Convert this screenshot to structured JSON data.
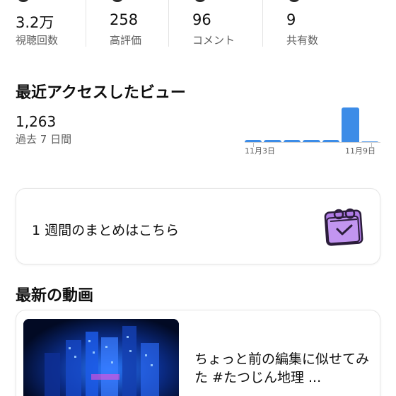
{
  "stats": [
    {
      "value": "3.2万",
      "label": "視聴回数"
    },
    {
      "value": "258",
      "label": "高評価"
    },
    {
      "value": "96",
      "label": "コメント"
    },
    {
      "value": "9",
      "label": "共有数"
    }
  ],
  "recent_views": {
    "title": "最近アクセスしたビュー",
    "value": "1,263",
    "period": "過去 7 日間",
    "tick_labels": [
      "11月3日",
      "11月9日"
    ],
    "daily_views": [
      {
        "day": "11月3日",
        "fraction": 0.08
      },
      {
        "day": "11月4日",
        "fraction": 0.08
      },
      {
        "day": "11月5日",
        "fraction": 0.09
      },
      {
        "day": "11月6日",
        "fraction": 0.09
      },
      {
        "day": "11月7日",
        "fraction": 0.09
      },
      {
        "day": "11月8日",
        "fraction": 1.0
      },
      {
        "day": "11月9日",
        "fraction": 0.02
      }
    ],
    "bar_color": "#3c8ce7"
  },
  "weekly_summary": {
    "text": "1 週間のまとめはこちら",
    "icon": "calendar-check-icon",
    "icon_color": "#b07be6"
  },
  "latest_videos": {
    "title": "最新の動画",
    "video": {
      "title": "ちょっと前の編集に似せてみた #たつじん地理 ..."
    }
  }
}
